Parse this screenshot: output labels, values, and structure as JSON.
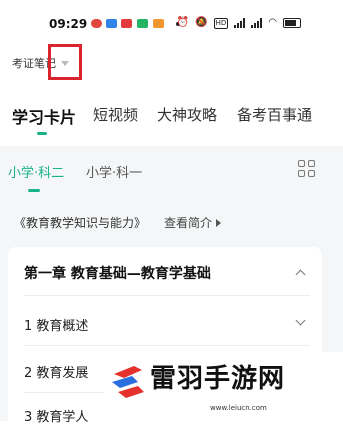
{
  "status_bar": {
    "time": "09:29",
    "app_icons": [
      {
        "name": "app-icon-red-circle",
        "color": "#e0483e"
      },
      {
        "name": "app-icon-blue",
        "color": "#2f86e8"
      },
      {
        "name": "app-icon-red-badge",
        "color": "#e33b3b"
      },
      {
        "name": "app-icon-green",
        "color": "#24b564"
      },
      {
        "name": "app-icon-orange",
        "color": "#f0962c"
      }
    ],
    "right_icons": [
      "alarm-icon",
      "mute-icon",
      "hd-icon",
      "signal-icon",
      "signal-icon",
      "wifi-icon",
      "battery-icon"
    ],
    "hd_label": "HD"
  },
  "exam_selector": {
    "label": "考证笔记"
  },
  "main_tabs": [
    {
      "label": "学习卡片",
      "active": true
    },
    {
      "label": "短视频",
      "active": false
    },
    {
      "label": "大神攻略",
      "active": false
    },
    {
      "label": "备考百事通",
      "active": false
    }
  ],
  "sub_tabs": [
    {
      "label": "小学·科二",
      "active": true
    },
    {
      "label": "小学·科一",
      "active": false
    }
  ],
  "book": {
    "title": "《教育教学知识与能力》",
    "intro_link": "查看简介"
  },
  "chapter": {
    "title": "第一章  教育基础—教育学基础",
    "items": [
      "1 教育概述",
      "2 教育发展",
      "3 教育学人"
    ]
  },
  "watermark": {
    "name": "雷羽手游网",
    "url": "www.leiucn.com"
  },
  "colors": {
    "accent": "#19b38a",
    "highlight_box": "#d9232d",
    "background_band": "#f4f6f7"
  }
}
